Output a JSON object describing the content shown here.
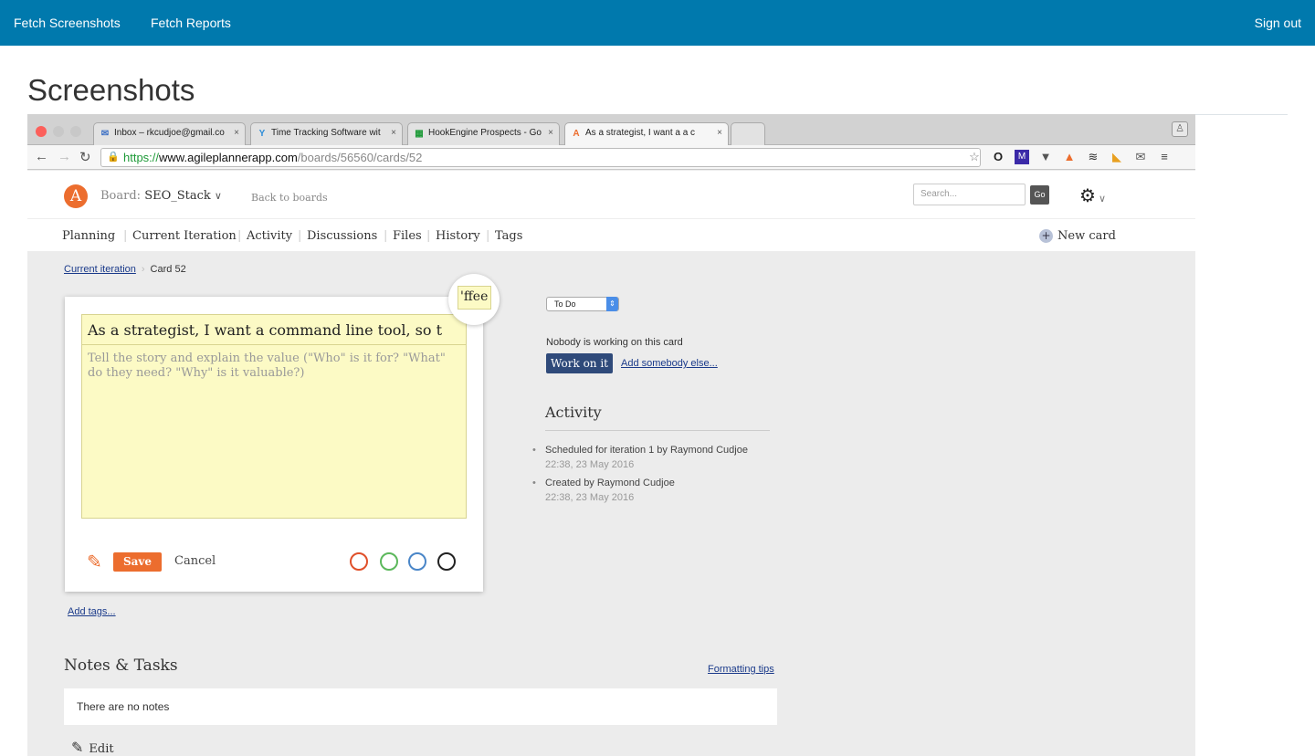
{
  "topnav": {
    "fetch_screenshots": "Fetch Screenshots",
    "fetch_reports": "Fetch Reports",
    "sign_out": "Sign out"
  },
  "page": {
    "title": "Screenshots"
  },
  "browser": {
    "tabs": [
      {
        "label": "Inbox – rkcudjoe@gmail.co",
        "icon": "mail-icon"
      },
      {
        "label": "Time Tracking Software wit",
        "icon": "fork-icon"
      },
      {
        "label": "HookEngine Prospects - Go",
        "icon": "sheets-icon"
      },
      {
        "label": "As a strategist, I want a a c",
        "icon": "agile-icon"
      }
    ],
    "url_scheme": "https://",
    "url_host": "www.agileplannerapp.com",
    "url_path": "/boards/56560/cards/52"
  },
  "app": {
    "logo": "A",
    "board_prefix": "Board:",
    "board_name": "SEO_Stack",
    "board_caret": "∨",
    "back_to_boards": "Back to boards",
    "search_placeholder": "Search...",
    "go": "Go",
    "menu": [
      "Planning",
      "Current Iteration",
      "Activity",
      "Discussions",
      "Files",
      "History",
      "Tags"
    ],
    "new_card": "New card",
    "breadcrumb": {
      "parent": "Current iteration",
      "current": "Card 52"
    },
    "card": {
      "title": "As a strategist, I want a command line tool, so t",
      "description_placeholder": "Tell the story and explain the value (\"Who\" is it for? \"What\" do they need? \"Why\" is it valuable?)",
      "save": "Save",
      "cancel": "Cancel",
      "magnifier_text": "'ffee",
      "swatch_colors": [
        "#e0502a",
        "#5cb85c",
        "#4a86c8",
        "#222222"
      ]
    },
    "add_tags": "Add tags...",
    "status": "To Do",
    "nobody_working": "Nobody is working on this card",
    "work_on_it": "Work on it",
    "add_somebody": "Add somebody else...",
    "activity_heading": "Activity",
    "activity": [
      {
        "text": "Scheduled for iteration 1 by Raymond Cudjoe",
        "when": "22:38, 23 May 2016"
      },
      {
        "text": "Created by Raymond Cudjoe",
        "when": "22:38, 23 May 2016"
      }
    ],
    "notes_heading": "Notes & Tasks",
    "formatting_tips": "Formatting tips",
    "no_notes": "There are no notes",
    "edit": "Edit"
  },
  "colors": {
    "topnav_bg": "#0079ad",
    "accent": "#ec6d2e",
    "card_yellow": "#fcfac5",
    "work_button": "#2f4a7a"
  }
}
